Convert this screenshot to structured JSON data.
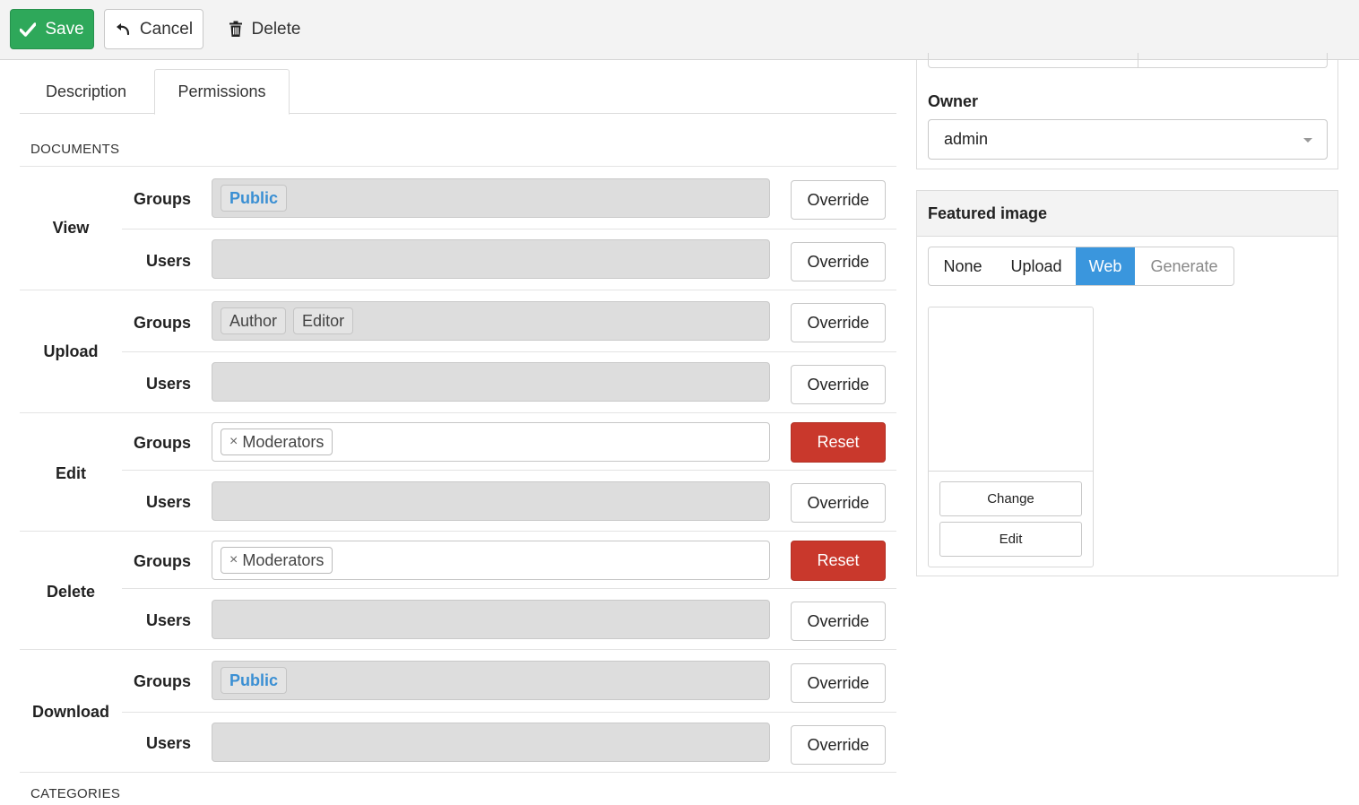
{
  "toolbar": {
    "save_label": "Save",
    "cancel_label": "Cancel",
    "delete_label": "Delete"
  },
  "tabs": [
    {
      "label": "Description",
      "active": false
    },
    {
      "label": "Permissions",
      "active": true
    }
  ],
  "sections": {
    "documents": "DOCUMENTS",
    "categories": "CATEGORIES"
  },
  "labels": {
    "groups": "Groups",
    "users": "Users",
    "override": "Override",
    "reset": "Reset",
    "remove": "×"
  },
  "permissions": [
    {
      "name": "View",
      "groups": [
        "Public"
      ],
      "groups_overridden": false,
      "users": []
    },
    {
      "name": "Upload",
      "groups": [
        "Author",
        "Editor"
      ],
      "groups_overridden": false,
      "users": []
    },
    {
      "name": "Edit",
      "groups": [
        "Moderators"
      ],
      "groups_overridden": true,
      "users": []
    },
    {
      "name": "Delete",
      "groups": [
        "Moderators"
      ],
      "groups_overridden": true,
      "users": []
    },
    {
      "name": "Download",
      "groups": [
        "Public"
      ],
      "groups_overridden": false,
      "users": []
    }
  ],
  "owner": {
    "label": "Owner",
    "value": "admin"
  },
  "featured_image": {
    "title": "Featured image",
    "options": [
      "None",
      "Upload",
      "Web",
      "Generate"
    ],
    "selected": "Web",
    "change_label": "Change",
    "edit_label": "Edit"
  },
  "colors": {
    "save": "#2ea85a",
    "reset": "#c9382c",
    "selected_segment": "#3a96dd",
    "public_tag": "#3a8fd3"
  }
}
